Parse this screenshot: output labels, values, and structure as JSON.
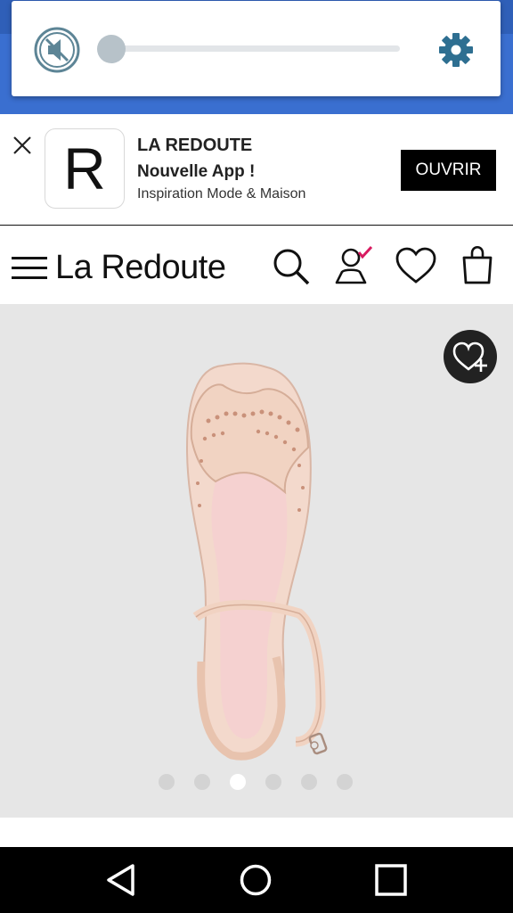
{
  "volume": {
    "level_percent": 0
  },
  "app_banner": {
    "icon_letter": "R",
    "title": "LA REDOUTE",
    "subtitle": "Nouvelle App !",
    "description": "Inspiration Mode & Maison",
    "open_label": "OUVRIR"
  },
  "header": {
    "logo": "La Redoute"
  },
  "gallery": {
    "image_count": 6,
    "active_index": 2
  },
  "colors": {
    "status_bar_blue": "#3a6fd0",
    "account_check_accent": "#d81b60",
    "settings_icon": "#2e6f91"
  },
  "icons": [
    "mute-icon",
    "settings-icon",
    "close-icon",
    "menu-icon",
    "search-icon",
    "account-icon",
    "heart-icon",
    "shopping-bag-icon",
    "wishlist-add-icon",
    "back-icon",
    "home-icon",
    "recents-icon"
  ]
}
